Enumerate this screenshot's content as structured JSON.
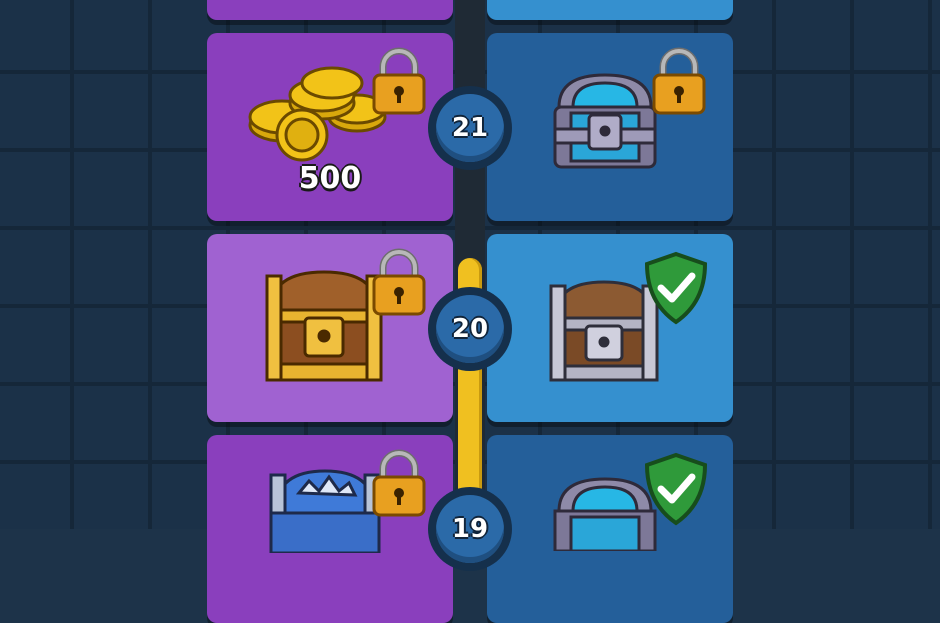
{
  "rows": [
    {
      "tier": "21",
      "free_reward_amount": "500",
      "free_reward": "gold-coins-icon",
      "free_locked": true,
      "premium_reward": "blue-chest-icon",
      "premium_locked": true
    },
    {
      "tier": "20",
      "free_reward": "wooden-chest-icon",
      "free_locked": true,
      "premium_reward": "silver-chest-icon",
      "premium_claimed": true
    },
    {
      "tier": "19",
      "free_reward": "diamond-chest-icon",
      "free_locked": true,
      "premium_reward": "blue-chest-icon",
      "premium_claimed": true
    }
  ],
  "progress_fraction": 0.5
}
